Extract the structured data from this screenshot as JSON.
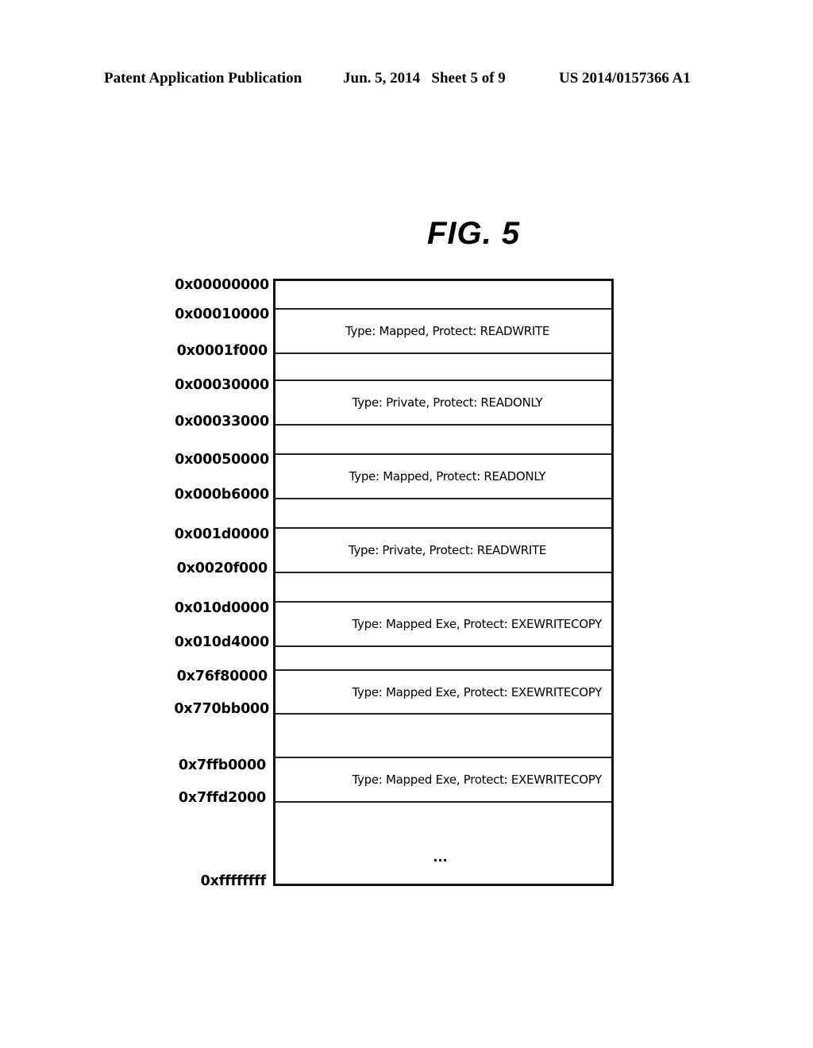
{
  "header": {
    "left": "Patent Application Publication",
    "middle": "Jun. 5, 2014   Sheet 5 of 9",
    "right": "US 2014/0157366 A1"
  },
  "figure": {
    "title": "FIG. 5",
    "addresses": [
      "0x00000000",
      "0x00010000",
      "0x0001f000",
      "0x00030000",
      "0x00033000",
      "0x00050000",
      "0x000b6000",
      "0x001d0000",
      "0x0020f000",
      "0x010d0000",
      "0x010d4000",
      "0x76f80000",
      "0x770bb000",
      "0x7ffb0000",
      "0x7ffd2000",
      "0xffffffff"
    ],
    "regions": [
      {
        "start": "0x00010000",
        "end": "0x0001f000",
        "label": "Type: Mapped, Protect: READWRITE"
      },
      {
        "start": "0x00030000",
        "end": "0x00033000",
        "label": "Type: Private, Protect: READONLY"
      },
      {
        "start": "0x00050000",
        "end": "0x000b6000",
        "label": "Type: Mapped, Protect: READONLY"
      },
      {
        "start": "0x001d0000",
        "end": "0x0020f000",
        "label": "Type: Private, Protect: READWRITE"
      },
      {
        "start": "0x010d0000",
        "end": "0x010d4000",
        "label": "Type: Mapped Exe, Protect: EXEWRITECOPY"
      },
      {
        "start": "0x76f80000",
        "end": "0x770bb000",
        "label": "Type: Mapped Exe, Protect: EXEWRITECOPY"
      },
      {
        "start": "0x7ffb0000",
        "end": "0x7ffd2000",
        "label": "Type: Mapped Exe, Protect: EXEWRITECOPY"
      }
    ],
    "continuation": "..."
  }
}
